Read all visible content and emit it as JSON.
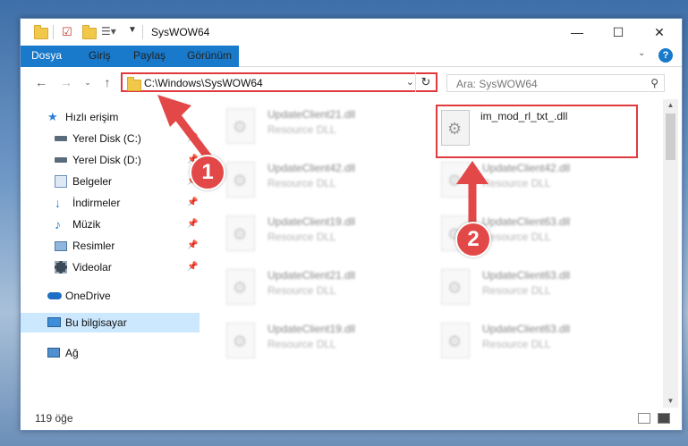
{
  "window": {
    "title": "SysWOW64"
  },
  "ribbon": {
    "tabs": [
      "Dosya",
      "Giriş",
      "Paylaş",
      "Görünüm"
    ]
  },
  "address": {
    "path": "C:\\Windows\\SysWOW64",
    "search_placeholder": "Ara: SysWOW64"
  },
  "nav": {
    "items": [
      {
        "label": "Hızlı erişim",
        "icon": "star-icon"
      },
      {
        "label": "Yerel Disk (C:)",
        "icon": "drive-icon",
        "pinned": true
      },
      {
        "label": "Yerel Disk (D:)",
        "icon": "drive-icon",
        "pinned": true
      },
      {
        "label": "Belgeler",
        "icon": "documents-icon",
        "pinned": true
      },
      {
        "label": "İndirmeler",
        "icon": "download-icon",
        "pinned": true
      },
      {
        "label": "Müzik",
        "icon": "music-icon",
        "pinned": true
      },
      {
        "label": "Resimler",
        "icon": "pictures-icon",
        "pinned": true
      },
      {
        "label": "Videolar",
        "icon": "videos-icon",
        "pinned": true
      },
      {
        "label": "OneDrive",
        "icon": "cloud-icon"
      },
      {
        "label": "Bu bilgisayar",
        "icon": "computer-icon",
        "selected": true
      },
      {
        "label": "Ağ",
        "icon": "network-icon"
      }
    ]
  },
  "files": {
    "highlighted": {
      "name": "im_mod_rl_txt_.dll"
    },
    "left_column": [
      {
        "name": "UpdateClient21.dll",
        "type": "Resource DLL"
      },
      {
        "name": "UpdateClient42.dll",
        "type": "Resource DLL"
      },
      {
        "name": "UpdateClient19.dll",
        "type": "Resource DLL"
      },
      {
        "name": "UpdateClient21.dll",
        "type": "Resource DLL"
      },
      {
        "name": "UpdateClient19.dll",
        "type": "Resource DLL"
      }
    ],
    "right_column": [
      {
        "name": "UpdateClient42.dll",
        "type": "Resource DLL"
      },
      {
        "name": "UpdateClient63.dll",
        "type": "Resource DLL"
      },
      {
        "name": "UpdateClient63.dll",
        "type": "Resource DLL"
      },
      {
        "name": "UpdateClient63.dll",
        "type": "Resource DLL"
      }
    ]
  },
  "status": {
    "count": "119 öğe"
  },
  "callouts": {
    "step1": "1",
    "step2": "2"
  },
  "colors": {
    "accent": "#1979ca",
    "highlight": "#e0393e",
    "selection": "#cce8ff"
  }
}
